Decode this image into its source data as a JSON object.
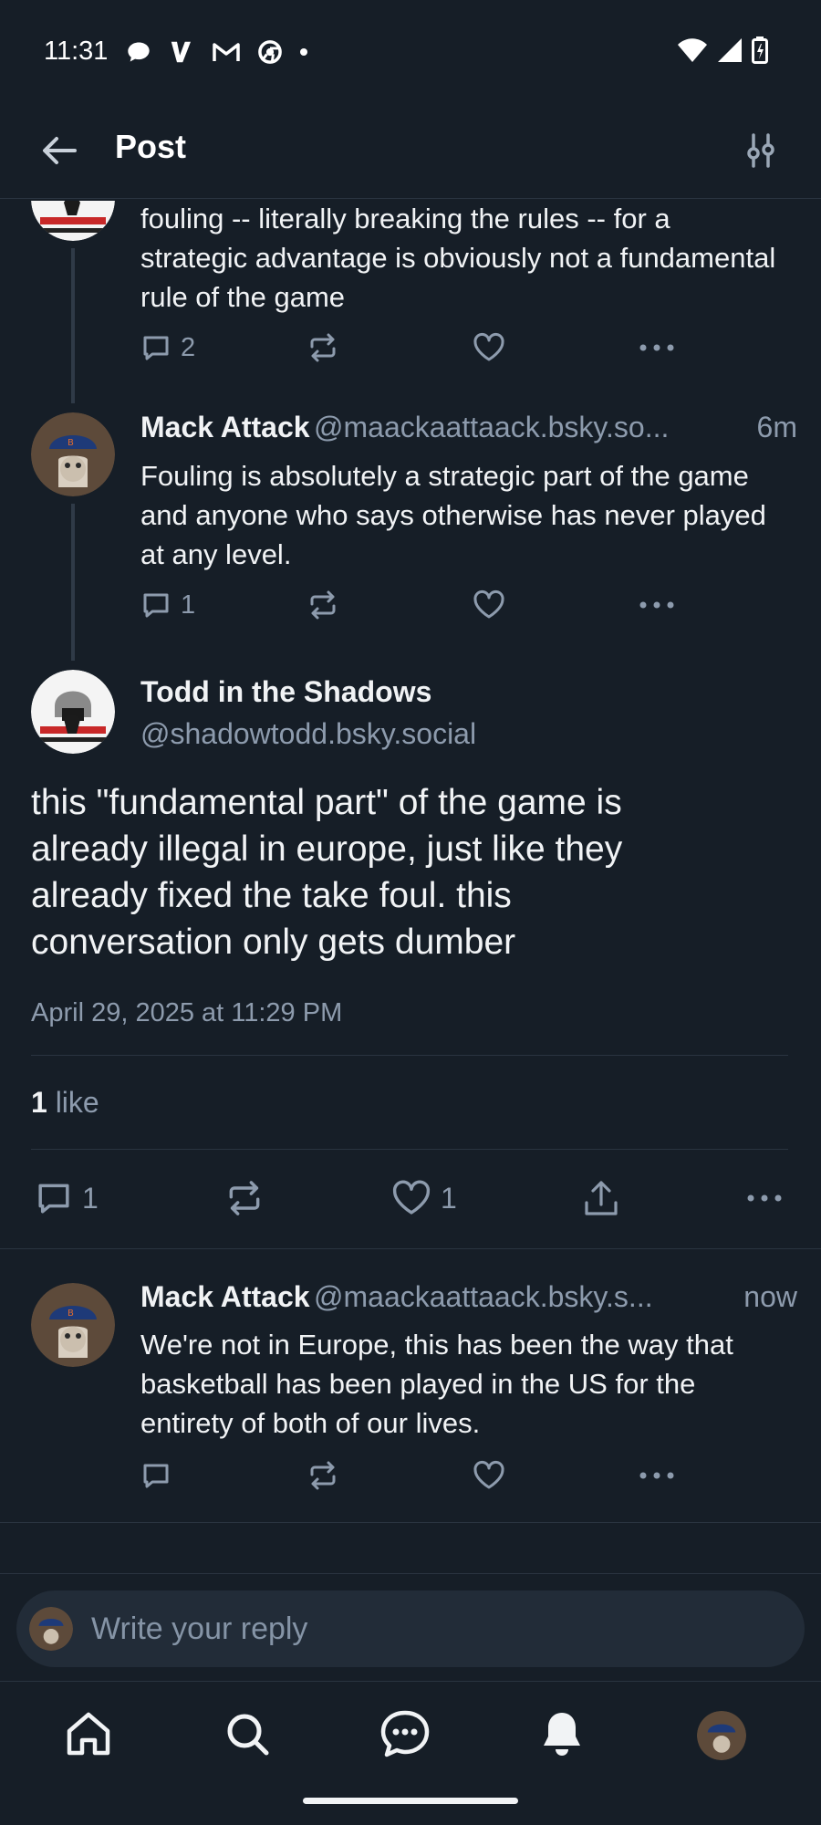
{
  "status_bar": {
    "time": "11:31"
  },
  "header": {
    "title": "Post"
  },
  "parent_post": {
    "text": "fouling -- literally breaking the rules -- for a strategic advantage is obviously not a fundamental rule of the game",
    "reply_count": "2"
  },
  "reply_post_1": {
    "author": "Mack Attack",
    "handle": "@maackaattaack.bsky.so...",
    "time": "6m",
    "text": "Fouling is absolutely a strategic part of the game and anyone who says otherwise has never played at any level.",
    "reply_count": "1"
  },
  "main_post": {
    "author": "Todd in the Shadows",
    "handle": "@shadowtodd.bsky.social",
    "text": "this \"fundamental part\" of the game is already illegal in europe, just like they already fixed the take foul. this conversation only gets dumber",
    "timestamp": "April 29, 2025 at 11:29 PM",
    "likes_count": "1",
    "likes_label": "like",
    "reply_count": "1",
    "like_count": "1"
  },
  "reply_post_2": {
    "author": "Mack Attack",
    "handle": "@maackaattaack.bsky.s...",
    "time": "now",
    "text": "We're not in Europe, this has been the way that basketball has been played in the US for the entirety of both of our lives."
  },
  "composer": {
    "placeholder": "Write your reply"
  },
  "colors": {
    "background": "#161e27",
    "muted": "#8d9bad",
    "divider": "#2a3440",
    "composer_bg": "#222c38"
  },
  "icons": [
    "back-arrow-icon",
    "filter-icon",
    "reply-icon",
    "repost-icon",
    "heart-icon",
    "more-icon",
    "share-icon",
    "home-icon",
    "search-icon",
    "chat-icon",
    "bell-icon"
  ]
}
